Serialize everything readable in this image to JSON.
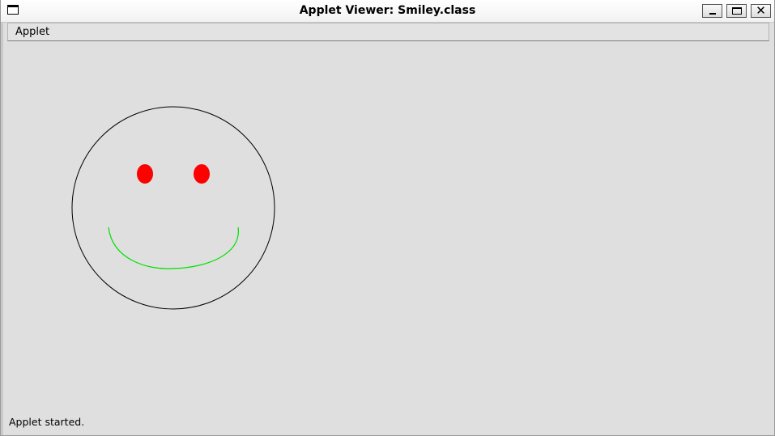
{
  "window": {
    "title": "Applet Viewer: Smiley.class"
  },
  "menubar": {
    "items": [
      {
        "label": "Applet"
      }
    ]
  },
  "applet": {
    "drawing": "smiley-face",
    "colors": {
      "face_outline": "#000000",
      "eyes": "#ff0000",
      "mouth": "#00e000"
    }
  },
  "status": {
    "text": "Applet started."
  }
}
